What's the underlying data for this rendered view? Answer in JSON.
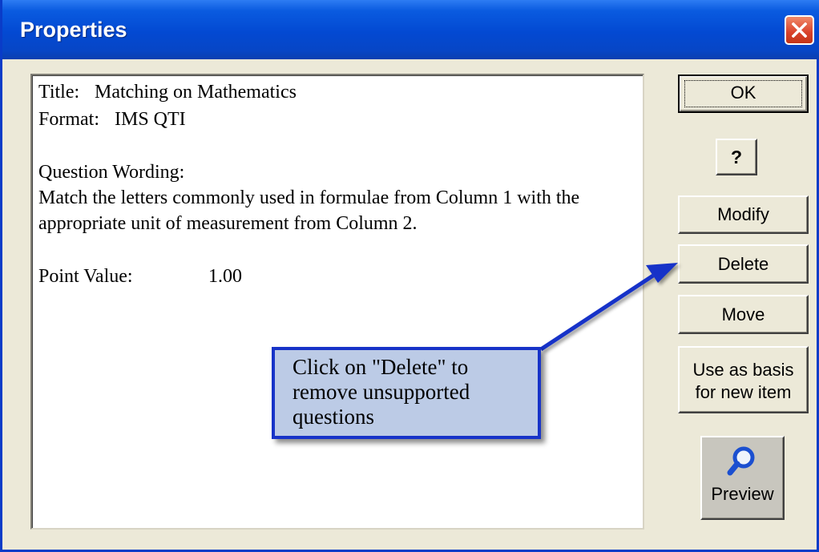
{
  "window": {
    "title": "Properties"
  },
  "content": {
    "title_label": "Title:",
    "title_value": "Matching on Mathematics",
    "format_label": "Format:",
    "format_value": "IMS QTI",
    "question_heading": "Question Wording:",
    "question_line1": "Match the letters commonly used in formulae from Column 1 with the",
    "question_line2": "appropriate unit of measurement from Column 2.",
    "point_label": "Point Value:",
    "point_value": "1.00"
  },
  "buttons": {
    "ok": "OK",
    "help": "?",
    "modify": "Modify",
    "delete": "Delete",
    "move": "Move",
    "basis_line1": "Use as basis",
    "basis_line2": "for new item",
    "preview": "Preview"
  },
  "callout": {
    "line1": "Click on \"Delete\" to",
    "line2": "remove unsupported",
    "line3": "questions"
  },
  "colors": {
    "titlebar": "#0349d2",
    "dialog_bg": "#ece9d8",
    "callout_fill": "#bccbe6",
    "callout_border": "#1733c8",
    "arrow": "#1733c8",
    "close_button": "#d9412a"
  },
  "icons": {
    "close": "close-x-icon",
    "preview": "magnifier-icon"
  }
}
